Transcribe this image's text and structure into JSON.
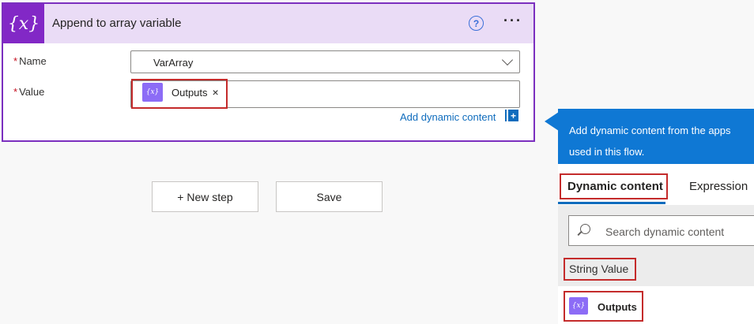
{
  "card": {
    "icon_glyph": "{x}",
    "title": "Append to array variable",
    "help_glyph": "?",
    "more_glyph": "···",
    "name_label": "Name",
    "name_value": "VarArray",
    "value_label": "Value",
    "required_mark": "*",
    "token_label": "Outputs",
    "token_icon": "{x}",
    "token_close": "×",
    "add_dynamic_content": "Add dynamic content",
    "add_dynamic_icon": "+"
  },
  "buttons": {
    "new_step": "+ New step",
    "save": "Save"
  },
  "panel": {
    "header_line1": "Add dynamic content from the apps",
    "header_line2": "used in this flow.",
    "tab_dynamic": "Dynamic content",
    "tab_expression": "Expression",
    "search_placeholder": "Search dynamic content",
    "section_title": "String Value",
    "result_label": "Outputs",
    "result_icon": "{x}"
  },
  "colors": {
    "accent_purple": "#8228c6",
    "highlight_red": "#c42b2b",
    "panel_blue": "#0f78d4",
    "link_blue": "#0f6cbd"
  }
}
